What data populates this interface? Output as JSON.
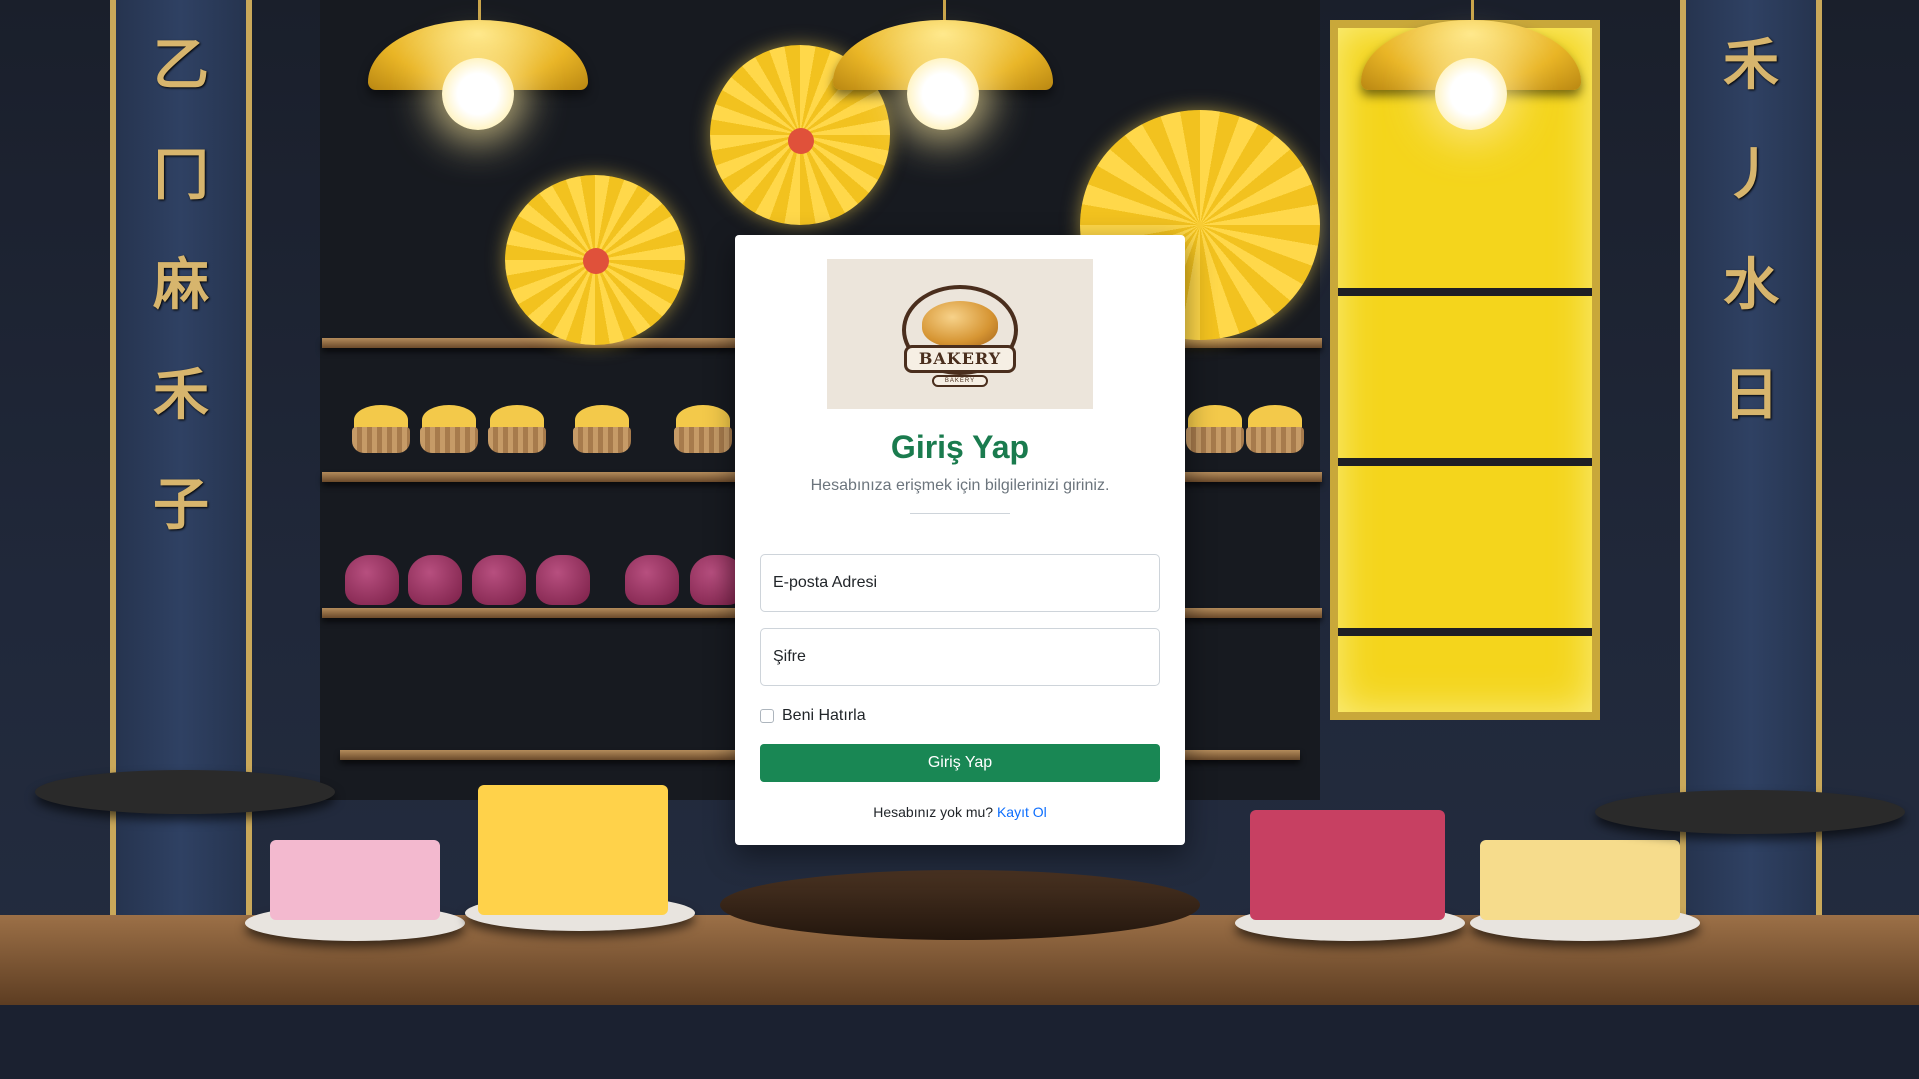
{
  "login": {
    "logo": {
      "brand": "BAKERY",
      "sub": "BAKERY"
    },
    "title": "Giriş Yap",
    "subtitle": "Hesabınıza erişmek için bilgilerinizi giriniz.",
    "email_placeholder": "E-posta Adresi",
    "password_placeholder": "Şifre",
    "remember_label": "Beni Hatırla",
    "remember_checked": false,
    "submit_label": "Giriş Yap",
    "register_prompt": "Hesabınız yok mu?",
    "register_link": "Kayıt Ol"
  },
  "colors": {
    "primary_green": "#198754",
    "title_green": "#1a7b4e",
    "link_blue": "#0d6efd",
    "muted_text": "#6c757d"
  }
}
